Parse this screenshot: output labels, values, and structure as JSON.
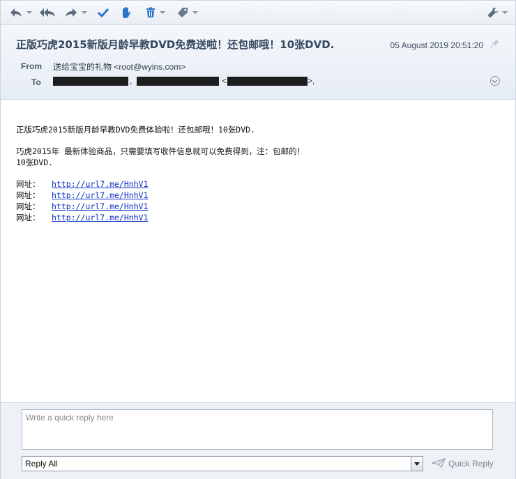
{
  "toolbar": {
    "icons": [
      "reply-icon",
      "reply-all-icon",
      "forward-icon",
      "mark-read-icon",
      "junk-icon",
      "delete-icon",
      "tag-icon",
      "settings-icon"
    ]
  },
  "header": {
    "subject": "正版巧虎2015新版月龄早教DVD免费送啦！还包邮哦！10张DVD.",
    "date": "05 August 2019 20:51:20",
    "from_label": "From",
    "from_value": "送给宝宝的礼物 <root@wyins.com>",
    "to_label": "To",
    "to_separators": [
      ",",
      "<",
      ">,"
    ]
  },
  "body": {
    "line1": "正版巧虎2015新版月龄早教DVD免费体验啦！还包邮哦！10张DVD.",
    "line2": "巧虎2015年 最新体验商品，只需要填写收件信息就可以免费得到，注：包邮的！",
    "line3": "10张DVD.",
    "links": [
      {
        "label": "网址：",
        "url": "http://url7.me/HnhV1"
      },
      {
        "label": "网址：",
        "url": "http://url7.me/HnhV1"
      },
      {
        "label": "网址：",
        "url": "http://url7.me/HnhV1"
      },
      {
        "label": "网址：",
        "url": "http://url7.me/HnhV1"
      }
    ]
  },
  "quick_reply": {
    "placeholder": "Write a quick reply here",
    "mode": "Reply All",
    "button_label": "Quick Reply"
  },
  "colors": {
    "subject": "#34475e",
    "link": "#0a2fc4",
    "accent_blue": "#2a74c9"
  }
}
